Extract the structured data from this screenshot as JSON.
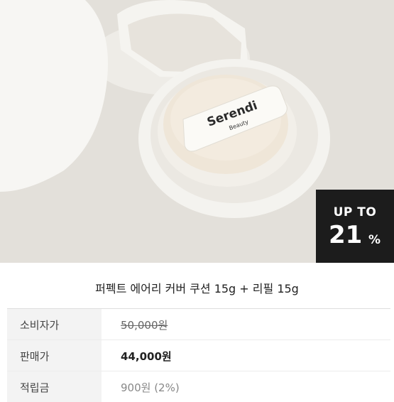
{
  "product": {
    "brand_line1": "Serendi",
    "brand_line2": "Beauty",
    "name": "퍼펙트 에어리 커버 쿠션 15g + 리필 15g"
  },
  "badge": {
    "top": "UP TO",
    "number": "21",
    "suffix": "%"
  },
  "table": {
    "rows": [
      {
        "label": "소비자가",
        "value": "50,000원"
      },
      {
        "label": "판매가",
        "value": "44,000원"
      },
      {
        "label": "적립금",
        "value": "900원 (2%)"
      }
    ]
  }
}
